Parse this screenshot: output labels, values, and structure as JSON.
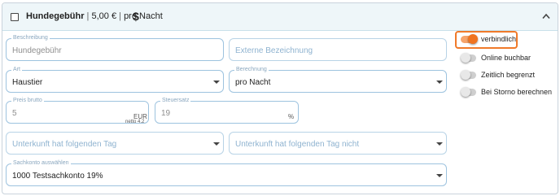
{
  "header": {
    "title": "Hundegebühr",
    "price": "5,00 €",
    "unit": "pro Nacht",
    "currency_symbol": "$"
  },
  "fields": {
    "beschreibung": {
      "label": "Beschreibung",
      "value": "Hundegebühr"
    },
    "externe_bezeichnung": {
      "placeholder": "Externe Bezeichnung"
    },
    "art": {
      "label": "Art",
      "value": "Haustier"
    },
    "berechnung": {
      "label": "Berechnung",
      "value": "pro Nacht"
    },
    "preis_brutto": {
      "label": "Preis brutto",
      "value": "5",
      "suffix": "EUR",
      "hint": "netto 4.2"
    },
    "steuersatz": {
      "label": "Steuersatz",
      "value": "19",
      "suffix": "%"
    },
    "unterkunft_tag": {
      "placeholder": "Unterkunft hat folgenden Tag"
    },
    "unterkunft_tag_nicht": {
      "placeholder": "Unterkunft hat folgenden Tag nicht"
    },
    "sachkonto": {
      "label": "Sachkonto auswählen",
      "value": "1000 Testsachkonto 19%"
    }
  },
  "toggles": [
    {
      "label": "verbindlich",
      "on": true
    },
    {
      "label": "Online buchbar",
      "on": false
    },
    {
      "label": "Zeitlich begrenzt",
      "on": false
    },
    {
      "label": "Bei Storno berechnen",
      "on": false
    }
  ],
  "colors": {
    "accent": "#f0731f",
    "field_border": "#9dc3df",
    "header_bg": "#eef6f9"
  }
}
